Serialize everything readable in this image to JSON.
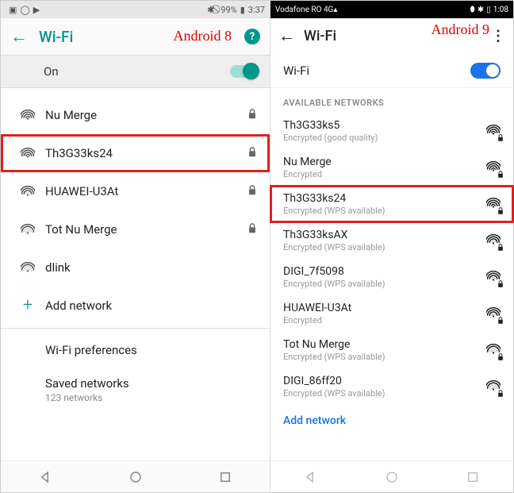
{
  "annotations": {
    "left": "Android 8",
    "right": "Android 9"
  },
  "a8": {
    "status": {
      "battery": "99%",
      "time": "3:37"
    },
    "appbar": {
      "title": "Wi-Fi"
    },
    "toggle": {
      "label": "On"
    },
    "networks": [
      {
        "name": "Nu Merge",
        "strength": 4,
        "locked": true,
        "hl": false
      },
      {
        "name": "Th3G33ks24",
        "strength": 4,
        "locked": true,
        "hl": true
      },
      {
        "name": "HUAWEI-U3At",
        "strength": 3,
        "locked": true,
        "hl": false
      },
      {
        "name": "Tot Nu Merge",
        "strength": 2,
        "locked": true,
        "hl": false
      },
      {
        "name": "dlink",
        "strength": 2,
        "locked": false,
        "hl": false
      }
    ],
    "add_label": "Add network",
    "prefs_label": "Wi-Fi preferences",
    "saved_label": "Saved networks",
    "saved_sub": "123 networks"
  },
  "a9": {
    "status": {
      "carrier": "Vodafone RO",
      "net": "4G",
      "time": "1:08"
    },
    "appbar": {
      "title": "Wi-Fi"
    },
    "toggle": {
      "label": "Wi-Fi"
    },
    "heading": "AVAILABLE NETWORKS",
    "networks": [
      {
        "name": "Th3G33ks5",
        "sub": "Encrypted (good quality)",
        "strength": 4,
        "locked": true,
        "hl": false
      },
      {
        "name": "Nu Merge",
        "sub": "Encrypted",
        "strength": 4,
        "locked": true,
        "hl": false
      },
      {
        "name": "Th3G33ks24",
        "sub": "Encrypted (WPS available)",
        "strength": 4,
        "locked": true,
        "hl": true
      },
      {
        "name": "Th3G33ksAX",
        "sub": "Encrypted (WPS available)",
        "strength": 3,
        "locked": true,
        "hl": false
      },
      {
        "name": "DIGI_7f5098",
        "sub": "Encrypted (WPS available)",
        "strength": 3,
        "locked": true,
        "hl": false
      },
      {
        "name": "HUAWEI-U3At",
        "sub": "Encrypted",
        "strength": 3,
        "locked": true,
        "hl": false
      },
      {
        "name": "Tot Nu Merge",
        "sub": "Encrypted (WPS available)",
        "strength": 2,
        "locked": true,
        "hl": false
      },
      {
        "name": "DIGI_86ff20",
        "sub": "Encrypted (WPS available)",
        "strength": 2,
        "locked": true,
        "hl": false
      }
    ],
    "add_label": "Add network"
  }
}
